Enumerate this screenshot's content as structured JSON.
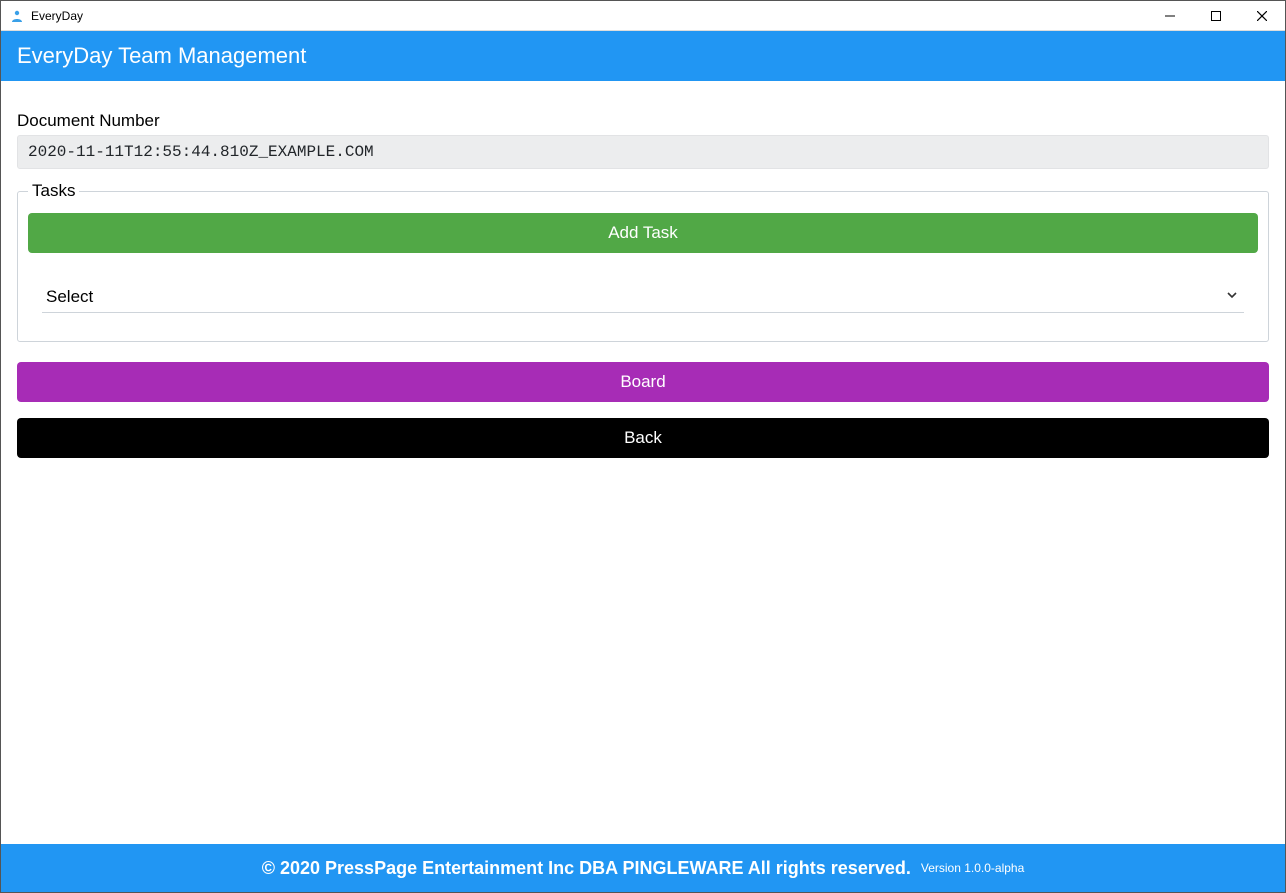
{
  "window": {
    "title": "EveryDay"
  },
  "header": {
    "title": "EveryDay Team Management"
  },
  "main": {
    "document_number_label": "Document Number",
    "document_number_value": "2020-11-11T12:55:44.810Z_EXAMPLE.COM",
    "tasks": {
      "legend": "Tasks",
      "add_task_label": "Add Task",
      "select_placeholder": "Select"
    },
    "board_button_label": "Board",
    "back_button_label": "Back"
  },
  "footer": {
    "copyright": "© 2020 PressPage Entertainment Inc DBA PINGLEWARE  All rights reserved.",
    "version": "Version 1.0.0-alpha"
  }
}
